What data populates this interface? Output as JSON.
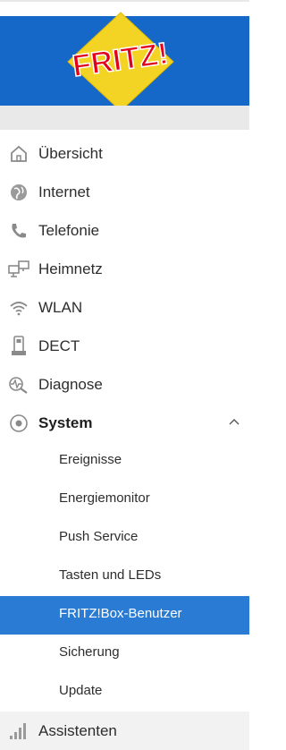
{
  "header": {
    "logo_text": "FRITZ!",
    "brand_color": "#1568c8",
    "logo_yellow": "#f3d324",
    "logo_red": "#e2001a"
  },
  "menu": {
    "items": [
      {
        "label": "Übersicht",
        "icon": "home-icon"
      },
      {
        "label": "Internet",
        "icon": "globe-icon"
      },
      {
        "label": "Telefonie",
        "icon": "phone-icon"
      },
      {
        "label": "Heimnetz",
        "icon": "network-icon"
      },
      {
        "label": "WLAN",
        "icon": "wifi-icon"
      },
      {
        "label": "DECT",
        "icon": "dect-phone-icon"
      },
      {
        "label": "Diagnose",
        "icon": "diagnose-icon"
      },
      {
        "label": "System",
        "icon": "system-icon",
        "expanded": true
      }
    ],
    "system_sub": [
      {
        "label": "Ereignisse"
      },
      {
        "label": "Energiemonitor"
      },
      {
        "label": "Push Service"
      },
      {
        "label": "Tasten und LEDs"
      },
      {
        "label": "FRITZ!Box-Benutzer",
        "active": true
      },
      {
        "label": "Sicherung"
      },
      {
        "label": "Update"
      }
    ],
    "assistants": {
      "label": "Assistenten",
      "icon": "signal-bars-icon"
    }
  },
  "colors": {
    "active_bg": "#2a7bd4",
    "icon_gray": "#8a8a8a"
  }
}
